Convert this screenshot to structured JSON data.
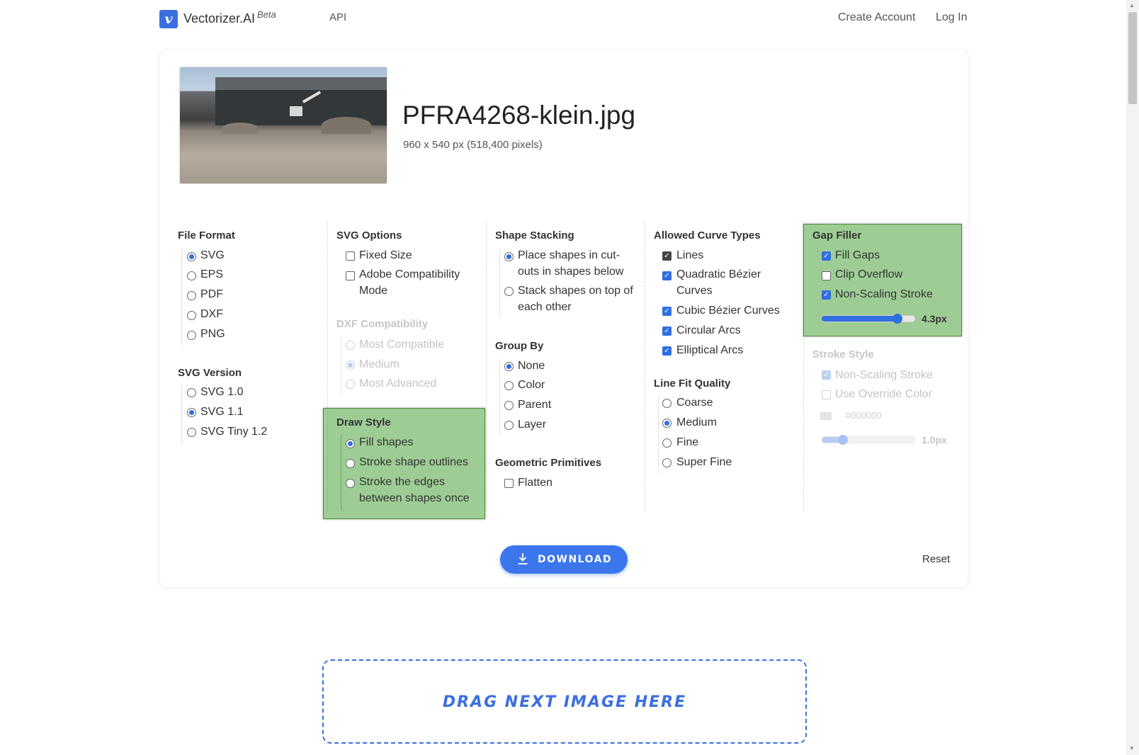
{
  "nav": {
    "logo_letter": "v",
    "brand": "Vectorizer.AI",
    "beta": "Beta",
    "api": "API",
    "create_account": "Create Account",
    "login": "Log In"
  },
  "file": {
    "name": "PFRA4268-klein.jpg",
    "meta": "960 x 540 px (518,400 pixels)"
  },
  "file_format": {
    "title": "File Format",
    "options": [
      "SVG",
      "EPS",
      "PDF",
      "DXF",
      "PNG"
    ],
    "selected": "SVG"
  },
  "svg_version": {
    "title": "SVG Version",
    "options": [
      "SVG 1.0",
      "SVG 1.1",
      "SVG Tiny 1.2"
    ],
    "selected": "SVG 1.1"
  },
  "svg_options": {
    "title": "SVG Options",
    "fixed_size": "Fixed Size",
    "adobe_line1": "Adobe Compatibility",
    "adobe_line2": "Mode"
  },
  "dxf_compat": {
    "title": "DXF Compatibility",
    "options": [
      "Most Compatible",
      "Medium",
      "Most Advanced"
    ],
    "selected": "Medium"
  },
  "draw_style": {
    "title": "Draw Style",
    "fill": "Fill shapes",
    "stroke_outlines": "Stroke shape outlines",
    "stroke_edges_line1": "Stroke the edges",
    "stroke_edges_line2": "between shapes once",
    "selected": "Fill shapes"
  },
  "shape_stacking": {
    "title": "Shape Stacking",
    "cutouts_line1": "Place shapes in cut-",
    "cutouts_line2": "outs in shapes below",
    "stack_line1": "Stack shapes on top of",
    "stack_line2": "each other"
  },
  "group_by": {
    "title": "Group By",
    "options": [
      "None",
      "Color",
      "Parent",
      "Layer"
    ],
    "selected": "None"
  },
  "geometric_primitives": {
    "title": "Geometric Primitives",
    "flatten": "Flatten"
  },
  "curve_types": {
    "title": "Allowed Curve Types",
    "lines": "Lines",
    "quad_line1": "Quadratic Bézier",
    "quad_line2": "Curves",
    "cubic": "Cubic Bézier Curves",
    "circular": "Circular Arcs",
    "elliptical": "Elliptical Arcs"
  },
  "line_fit": {
    "title": "Line Fit Quality",
    "options": [
      "Coarse",
      "Medium",
      "Fine",
      "Super Fine"
    ],
    "selected": "Medium"
  },
  "gap_filler": {
    "title": "Gap Filler",
    "fill_gaps": "Fill Gaps",
    "clip_overflow": "Clip Overflow",
    "non_scaling": "Non-Scaling Stroke",
    "stroke_value": "4.3px",
    "slider_fraction": 0.82
  },
  "stroke_style": {
    "title": "Stroke Style",
    "non_scaling": "Non-Scaling Stroke",
    "override": "Use Override Color",
    "color": "#000000",
    "stroke_value": "1.0px",
    "slider_fraction": 0.23
  },
  "actions": {
    "download": "DOWNLOAD",
    "reset": "Reset"
  },
  "dropzone": {
    "label": "DRAG NEXT IMAGE HERE"
  },
  "colors": {
    "accent": "#3b76ec",
    "highlight": "#8cc97f"
  }
}
